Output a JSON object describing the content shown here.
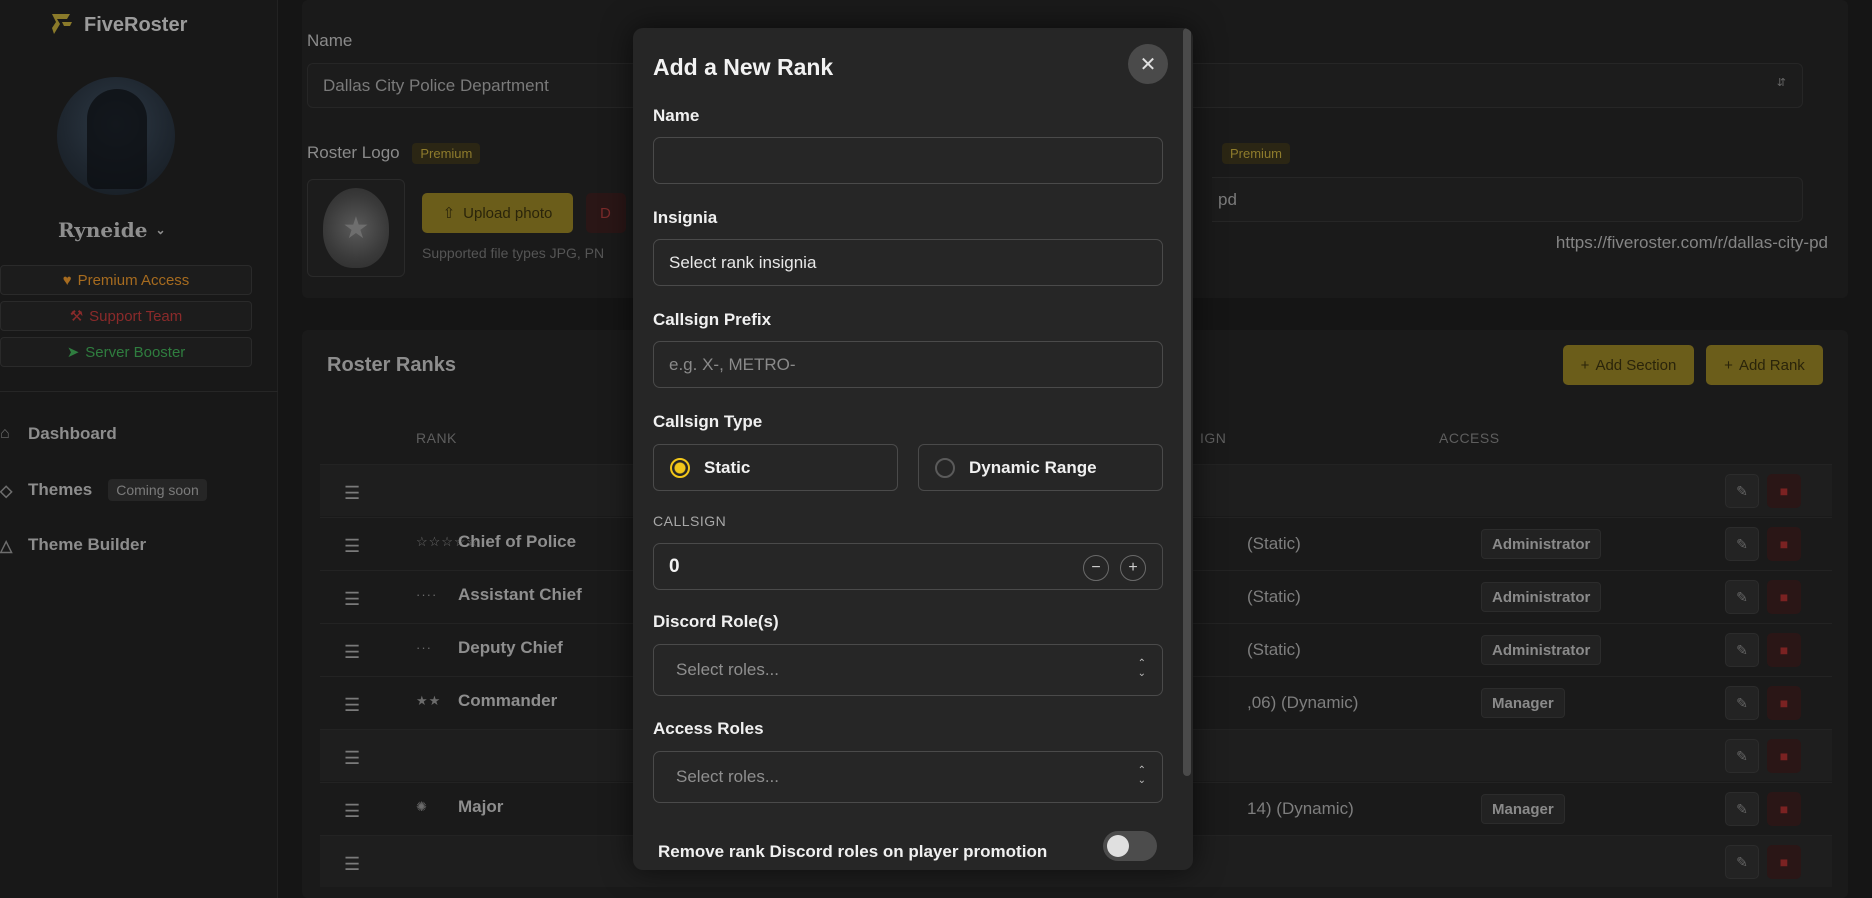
{
  "brand": {
    "name": "FiveRoster"
  },
  "user": {
    "name": "Ryneide"
  },
  "sidebar": {
    "badges": [
      {
        "label": "Premium Access",
        "icon": "heart-icon"
      },
      {
        "label": "Support Team",
        "icon": "tools-icon"
      },
      {
        "label": "Server Booster",
        "icon": "rocket-icon"
      }
    ],
    "nav": [
      {
        "label": "Dashboard",
        "icon": "home-icon"
      },
      {
        "label": "Themes",
        "icon": "diamond-icon",
        "badge": "Coming soon"
      },
      {
        "label": "Theme Builder",
        "icon": "shapes-icon"
      }
    ]
  },
  "roster_settings": {
    "name_label": "Name",
    "name_value": "Dallas City Police Department",
    "logo_label": "Roster Logo",
    "premium_badge": "Premium",
    "upload_label": "Upload photo",
    "delete_label": "D",
    "supported_text": "Supported file types JPG, PN",
    "slug_premium_badge": "Premium",
    "slug_value": "pd",
    "url_text": "https://fiveroster.com/r/dallas-city-pd"
  },
  "ranks_section": {
    "title": "Roster Ranks",
    "add_section_label": "Add Section",
    "add_rank_label": "Add Rank",
    "columns": {
      "rank": "RANK",
      "callsign": "IGN",
      "access": "ACCESS"
    },
    "rows": [
      {
        "type": "section",
        "name": "",
        "insignia": "",
        "callsign": "",
        "access": ""
      },
      {
        "type": "rank",
        "name": "Chief of Police",
        "insignia": "☆☆☆☆☆",
        "callsign": "(Static)",
        "access": "Administrator"
      },
      {
        "type": "rank",
        "name": "Assistant Chief",
        "insignia": "····",
        "callsign": "(Static)",
        "access": "Administrator"
      },
      {
        "type": "rank",
        "name": "Deputy Chief",
        "insignia": "···",
        "callsign": "(Static)",
        "access": "Administrator"
      },
      {
        "type": "rank",
        "name": "Commander",
        "insignia": "★★",
        "callsign": ",06) (Dynamic)",
        "access": "Manager"
      },
      {
        "type": "section",
        "name": "",
        "insignia": "",
        "callsign": "",
        "access": ""
      },
      {
        "type": "rank",
        "name": "Major",
        "insignia": "✺",
        "callsign": "14) (Dynamic)",
        "access": "Manager"
      },
      {
        "type": "section",
        "name": "",
        "insignia": "",
        "callsign": "",
        "access": ""
      }
    ]
  },
  "modal": {
    "title": "Add a New Rank",
    "name_label": "Name",
    "name_value": "",
    "insignia_label": "Insignia",
    "insignia_value": "Select rank insignia",
    "callsign_prefix_label": "Callsign Prefix",
    "callsign_prefix_placeholder": "e.g. X-, METRO-",
    "callsign_type_label": "Callsign Type",
    "callsign_type_options": [
      {
        "label": "Static",
        "selected": true
      },
      {
        "label": "Dynamic Range",
        "selected": false
      }
    ],
    "callsign_label": "CALLSIGN",
    "callsign_value": "0",
    "discord_roles_label": "Discord Role(s)",
    "discord_roles_placeholder": "Select roles...",
    "access_roles_label": "Access Roles",
    "access_roles_placeholder": "Select roles...",
    "remove_roles_label": "Remove rank Discord roles on player promotion",
    "remove_roles_enabled": false
  },
  "colors": {
    "accent": "#f2c71a",
    "modal_bg": "#262626",
    "page_bg": "#151515"
  }
}
